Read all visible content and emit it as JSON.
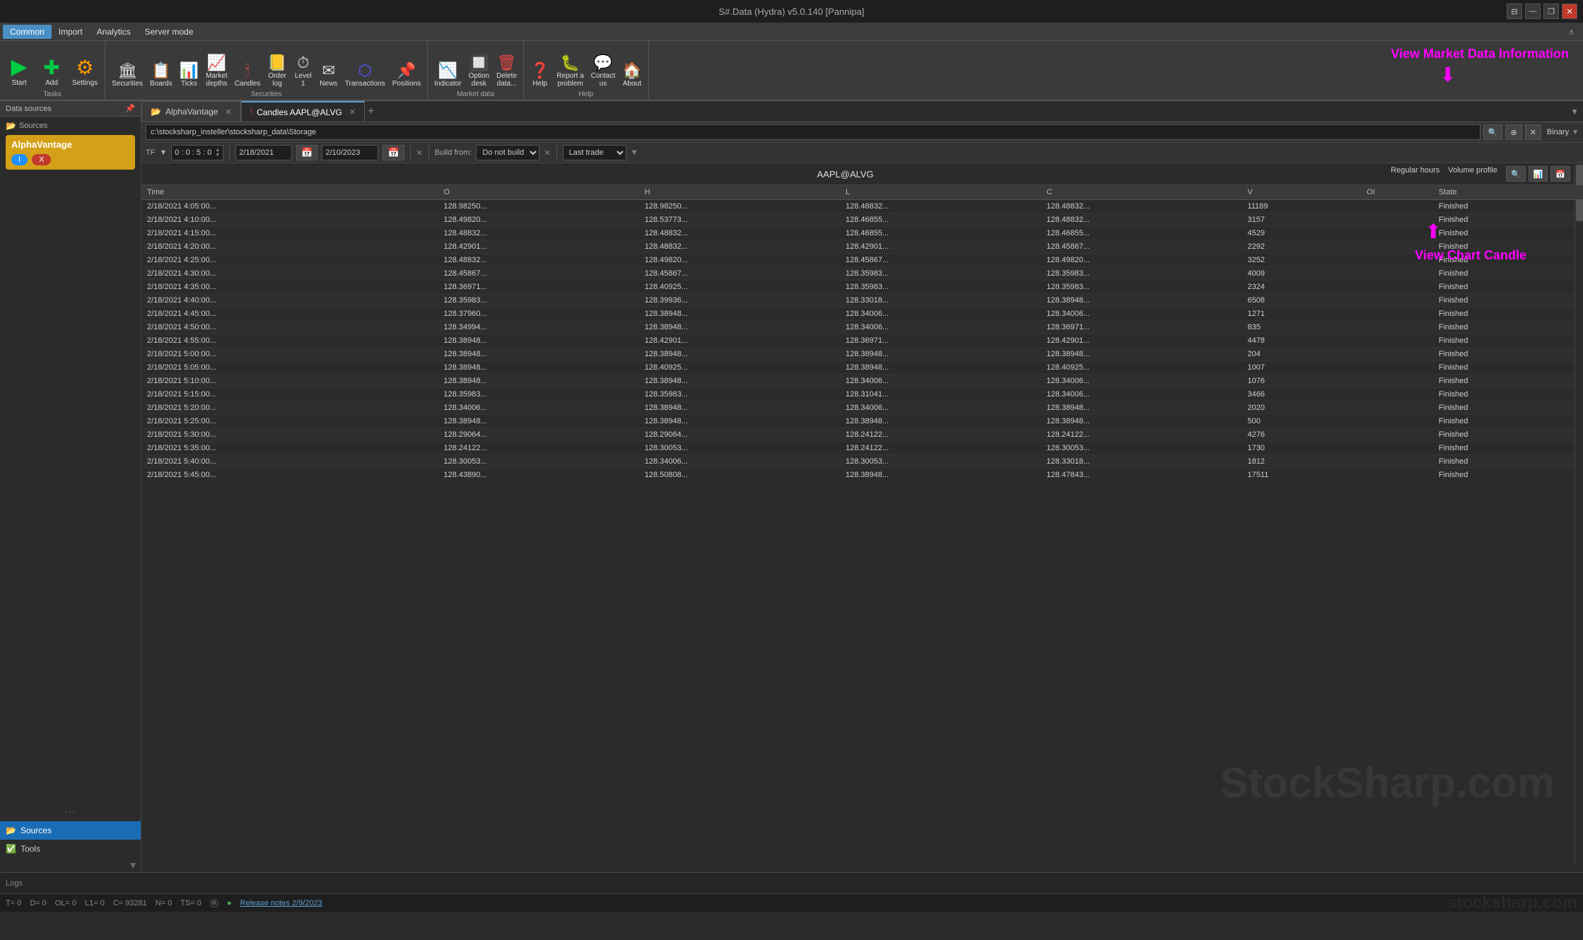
{
  "title_bar": {
    "title": "S#.Data (Hydra) v5.0.140 [Pannipa]",
    "controls": [
      "restore",
      "minimize",
      "maximize",
      "close"
    ]
  },
  "menu": {
    "items": [
      "Common",
      "Import",
      "Analytics",
      "Server mode"
    ],
    "active": "Common",
    "collapse_label": "^"
  },
  "ribbon": {
    "groups": [
      {
        "label": "Tasks",
        "buttons": [
          {
            "id": "start",
            "label": "Start",
            "icon": "▶"
          },
          {
            "id": "add",
            "label": "Add",
            "icon": "➕"
          },
          {
            "id": "settings",
            "label": "Settings",
            "icon": "⚙"
          }
        ]
      },
      {
        "label": "Securities",
        "buttons": [
          {
            "id": "securities",
            "label": "Securities",
            "icon": "🏛"
          },
          {
            "id": "boards",
            "label": "Boards",
            "icon": "📋"
          },
          {
            "id": "ticks",
            "label": "Ticks",
            "icon": "📊"
          },
          {
            "id": "market-depths",
            "label": "Market\ndepths",
            "icon": "📈"
          },
          {
            "id": "candles",
            "label": "Candles",
            "icon": "🕯"
          },
          {
            "id": "order-log",
            "label": "Order\nlog",
            "icon": "📒"
          },
          {
            "id": "level1",
            "label": "Level\n1",
            "icon": "⏱"
          },
          {
            "id": "news",
            "label": "News",
            "icon": "✉"
          },
          {
            "id": "transactions",
            "label": "Transactions",
            "icon": "🔷"
          },
          {
            "id": "positions",
            "label": "Positions",
            "icon": "📌"
          }
        ]
      },
      {
        "label": "Market data",
        "buttons": [
          {
            "id": "indicator",
            "label": "Indicator",
            "icon": "📉"
          },
          {
            "id": "option-desk",
            "label": "Option\ndesk",
            "icon": "🔲"
          },
          {
            "id": "delete-data",
            "label": "Delete\ndata...",
            "icon": "🗑"
          }
        ]
      },
      {
        "label": "Help",
        "buttons": [
          {
            "id": "help",
            "label": "Help",
            "icon": "❓"
          },
          {
            "id": "report-problem",
            "label": "Report a\nproblem",
            "icon": "🐛"
          },
          {
            "id": "contact-us",
            "label": "Contact\nus",
            "icon": "💬"
          },
          {
            "id": "about",
            "label": "About",
            "icon": "🏠"
          }
        ]
      }
    ],
    "annotation": "View Market Data Information"
  },
  "sidebar": {
    "header": "Data sources",
    "pin_label": "📌",
    "sources_label": "Sources",
    "alpha_vantage": {
      "title": "AlphaVantage",
      "toggle_label": "I",
      "close_label": "X"
    },
    "nav": [
      {
        "id": "sources",
        "label": "Sources",
        "icon": "📂",
        "active": true
      },
      {
        "id": "tools",
        "label": "Tools",
        "icon": "✅",
        "active": false
      }
    ]
  },
  "tabs": [
    {
      "id": "alphavantage",
      "label": "AlphaVantage",
      "active": false,
      "closeable": true
    },
    {
      "id": "candles",
      "label": "Candles AAPL@ALVG",
      "active": true,
      "closeable": true
    }
  ],
  "toolbar": {
    "path": "c:\\stocksharp_insteller\\stocksharp_data\\Storage",
    "binary_label": "Binary"
  },
  "toolbar2": {
    "tf_label": "TF",
    "tf_value": "0 : 0 : 5 : 0",
    "date_from": "2/18/2021",
    "date_to": "2/10/2023",
    "build_from_label": "Build from:",
    "build_from_value": "Do not build",
    "last_trade_label": "Last trade"
  },
  "symbol_header": {
    "title": "AAPL@ALVG",
    "regular_hours_label": "Regular hours",
    "volume_profile_label": "Volume profile"
  },
  "table": {
    "columns": [
      "Time",
      "O",
      "H",
      "L",
      "C",
      "V",
      "OI",
      "State"
    ],
    "rows": [
      {
        "time": "2/18/2021 4:05:00...",
        "o": "128.98250...",
        "h": "128.98250...",
        "l": "128.48832...",
        "c": "128.48832...",
        "v": "11189",
        "oi": "",
        "state": "Finished"
      },
      {
        "time": "2/18/2021 4:10:00...",
        "o": "128.49820...",
        "h": "128.53773...",
        "l": "128.46855...",
        "c": "128.48832...",
        "v": "3157",
        "oi": "",
        "state": "Finished"
      },
      {
        "time": "2/18/2021 4:15:00...",
        "o": "128.48832...",
        "h": "128.48832...",
        "l": "128.46855...",
        "c": "128.46855...",
        "v": "4529",
        "oi": "",
        "state": "Finished"
      },
      {
        "time": "2/18/2021 4:20:00...",
        "o": "128.42901...",
        "h": "128.48832...",
        "l": "128.42901...",
        "c": "128.45867...",
        "v": "2292",
        "oi": "",
        "state": "Finished"
      },
      {
        "time": "2/18/2021 4:25:00...",
        "o": "128.48832...",
        "h": "128.49820...",
        "l": "128.45867...",
        "c": "128.49820...",
        "v": "3252",
        "oi": "",
        "state": "Finished"
      },
      {
        "time": "2/18/2021 4:30:00...",
        "o": "128.45867...",
        "h": "128.45867...",
        "l": "128.35983...",
        "c": "128.35983...",
        "v": "4009",
        "oi": "",
        "state": "Finished"
      },
      {
        "time": "2/18/2021 4:35:00...",
        "o": "128.36971...",
        "h": "128.40925...",
        "l": "128.35983...",
        "c": "128.35983...",
        "v": "2324",
        "oi": "",
        "state": "Finished"
      },
      {
        "time": "2/18/2021 4:40:00...",
        "o": "128.35983...",
        "h": "128.39936...",
        "l": "128.33018...",
        "c": "128.38948...",
        "v": "6508",
        "oi": "",
        "state": "Finished"
      },
      {
        "time": "2/18/2021 4:45:00...",
        "o": "128.37960...",
        "h": "128.38948...",
        "l": "128.34006...",
        "c": "128.34006...",
        "v": "1271",
        "oi": "",
        "state": "Finished"
      },
      {
        "time": "2/18/2021 4:50:00...",
        "o": "128.34994...",
        "h": "128.38948...",
        "l": "128.34006...",
        "c": "128.36971...",
        "v": "835",
        "oi": "",
        "state": "Finished"
      },
      {
        "time": "2/18/2021 4:55:00...",
        "o": "128.38948...",
        "h": "128.42901...",
        "l": "128.36971...",
        "c": "128.42901...",
        "v": "4478",
        "oi": "",
        "state": "Finished"
      },
      {
        "time": "2/18/2021 5:00:00...",
        "o": "128.38948...",
        "h": "128.38948...",
        "l": "128.38948...",
        "c": "128.38948...",
        "v": "204",
        "oi": "",
        "state": "Finished"
      },
      {
        "time": "2/18/2021 5:05:00...",
        "o": "128.38948...",
        "h": "128.40925...",
        "l": "128.38948...",
        "c": "128.40925...",
        "v": "1007",
        "oi": "",
        "state": "Finished"
      },
      {
        "time": "2/18/2021 5:10:00...",
        "o": "128.38948...",
        "h": "128.38948...",
        "l": "128.34006...",
        "c": "128.34006...",
        "v": "1076",
        "oi": "",
        "state": "Finished"
      },
      {
        "time": "2/18/2021 5:15:00...",
        "o": "128.35983...",
        "h": "128.35983...",
        "l": "128.31041...",
        "c": "128.34006...",
        "v": "3466",
        "oi": "",
        "state": "Finished"
      },
      {
        "time": "2/18/2021 5:20:00...",
        "o": "128.34006...",
        "h": "128.38948...",
        "l": "128.34006...",
        "c": "128.38948...",
        "v": "2020",
        "oi": "",
        "state": "Finished"
      },
      {
        "time": "2/18/2021 5:25:00...",
        "o": "128.38948...",
        "h": "128.38948...",
        "l": "128.38948...",
        "c": "128.38948...",
        "v": "500",
        "oi": "",
        "state": "Finished"
      },
      {
        "time": "2/18/2021 5:30:00...",
        "o": "128.29064...",
        "h": "128.29064...",
        "l": "128.24122...",
        "c": "128.24122...",
        "v": "4276",
        "oi": "",
        "state": "Finished"
      },
      {
        "time": "2/18/2021 5:35:00...",
        "o": "128.24122...",
        "h": "128.30053...",
        "l": "128.24122...",
        "c": "128.30053...",
        "v": "1730",
        "oi": "",
        "state": "Finished"
      },
      {
        "time": "2/18/2021 5:40:00...",
        "o": "128.30053...",
        "h": "128.34006...",
        "l": "128.30053...",
        "c": "128.33018...",
        "v": "1812",
        "oi": "",
        "state": "Finished"
      },
      {
        "time": "2/18/2021 5:45:00...",
        "o": "128.43890...",
        "h": "128.50808...",
        "l": "128.38948...",
        "c": "128.47843...",
        "v": "17511",
        "oi": "",
        "state": "Finished"
      }
    ]
  },
  "status_bar": {
    "items": [
      {
        "key": "T",
        "value": "0"
      },
      {
        "key": "D",
        "value": "0"
      },
      {
        "key": "OL",
        "value": "0"
      },
      {
        "key": "L1",
        "value": "0"
      },
      {
        "key": "C",
        "value": "93281"
      },
      {
        "key": "N",
        "value": "0"
      },
      {
        "key": "TS",
        "value": "0"
      }
    ],
    "indicator": "●",
    "release_notes": "Release notes 2/9/2023"
  },
  "logs": {
    "label": "Logs"
  },
  "annotations": {
    "view_market_data": "View Market Data Information",
    "view_chart_candle": "View Chart Candle"
  },
  "watermark": "StockSharp.com",
  "bottom_watermark": "stocksharp.com"
}
